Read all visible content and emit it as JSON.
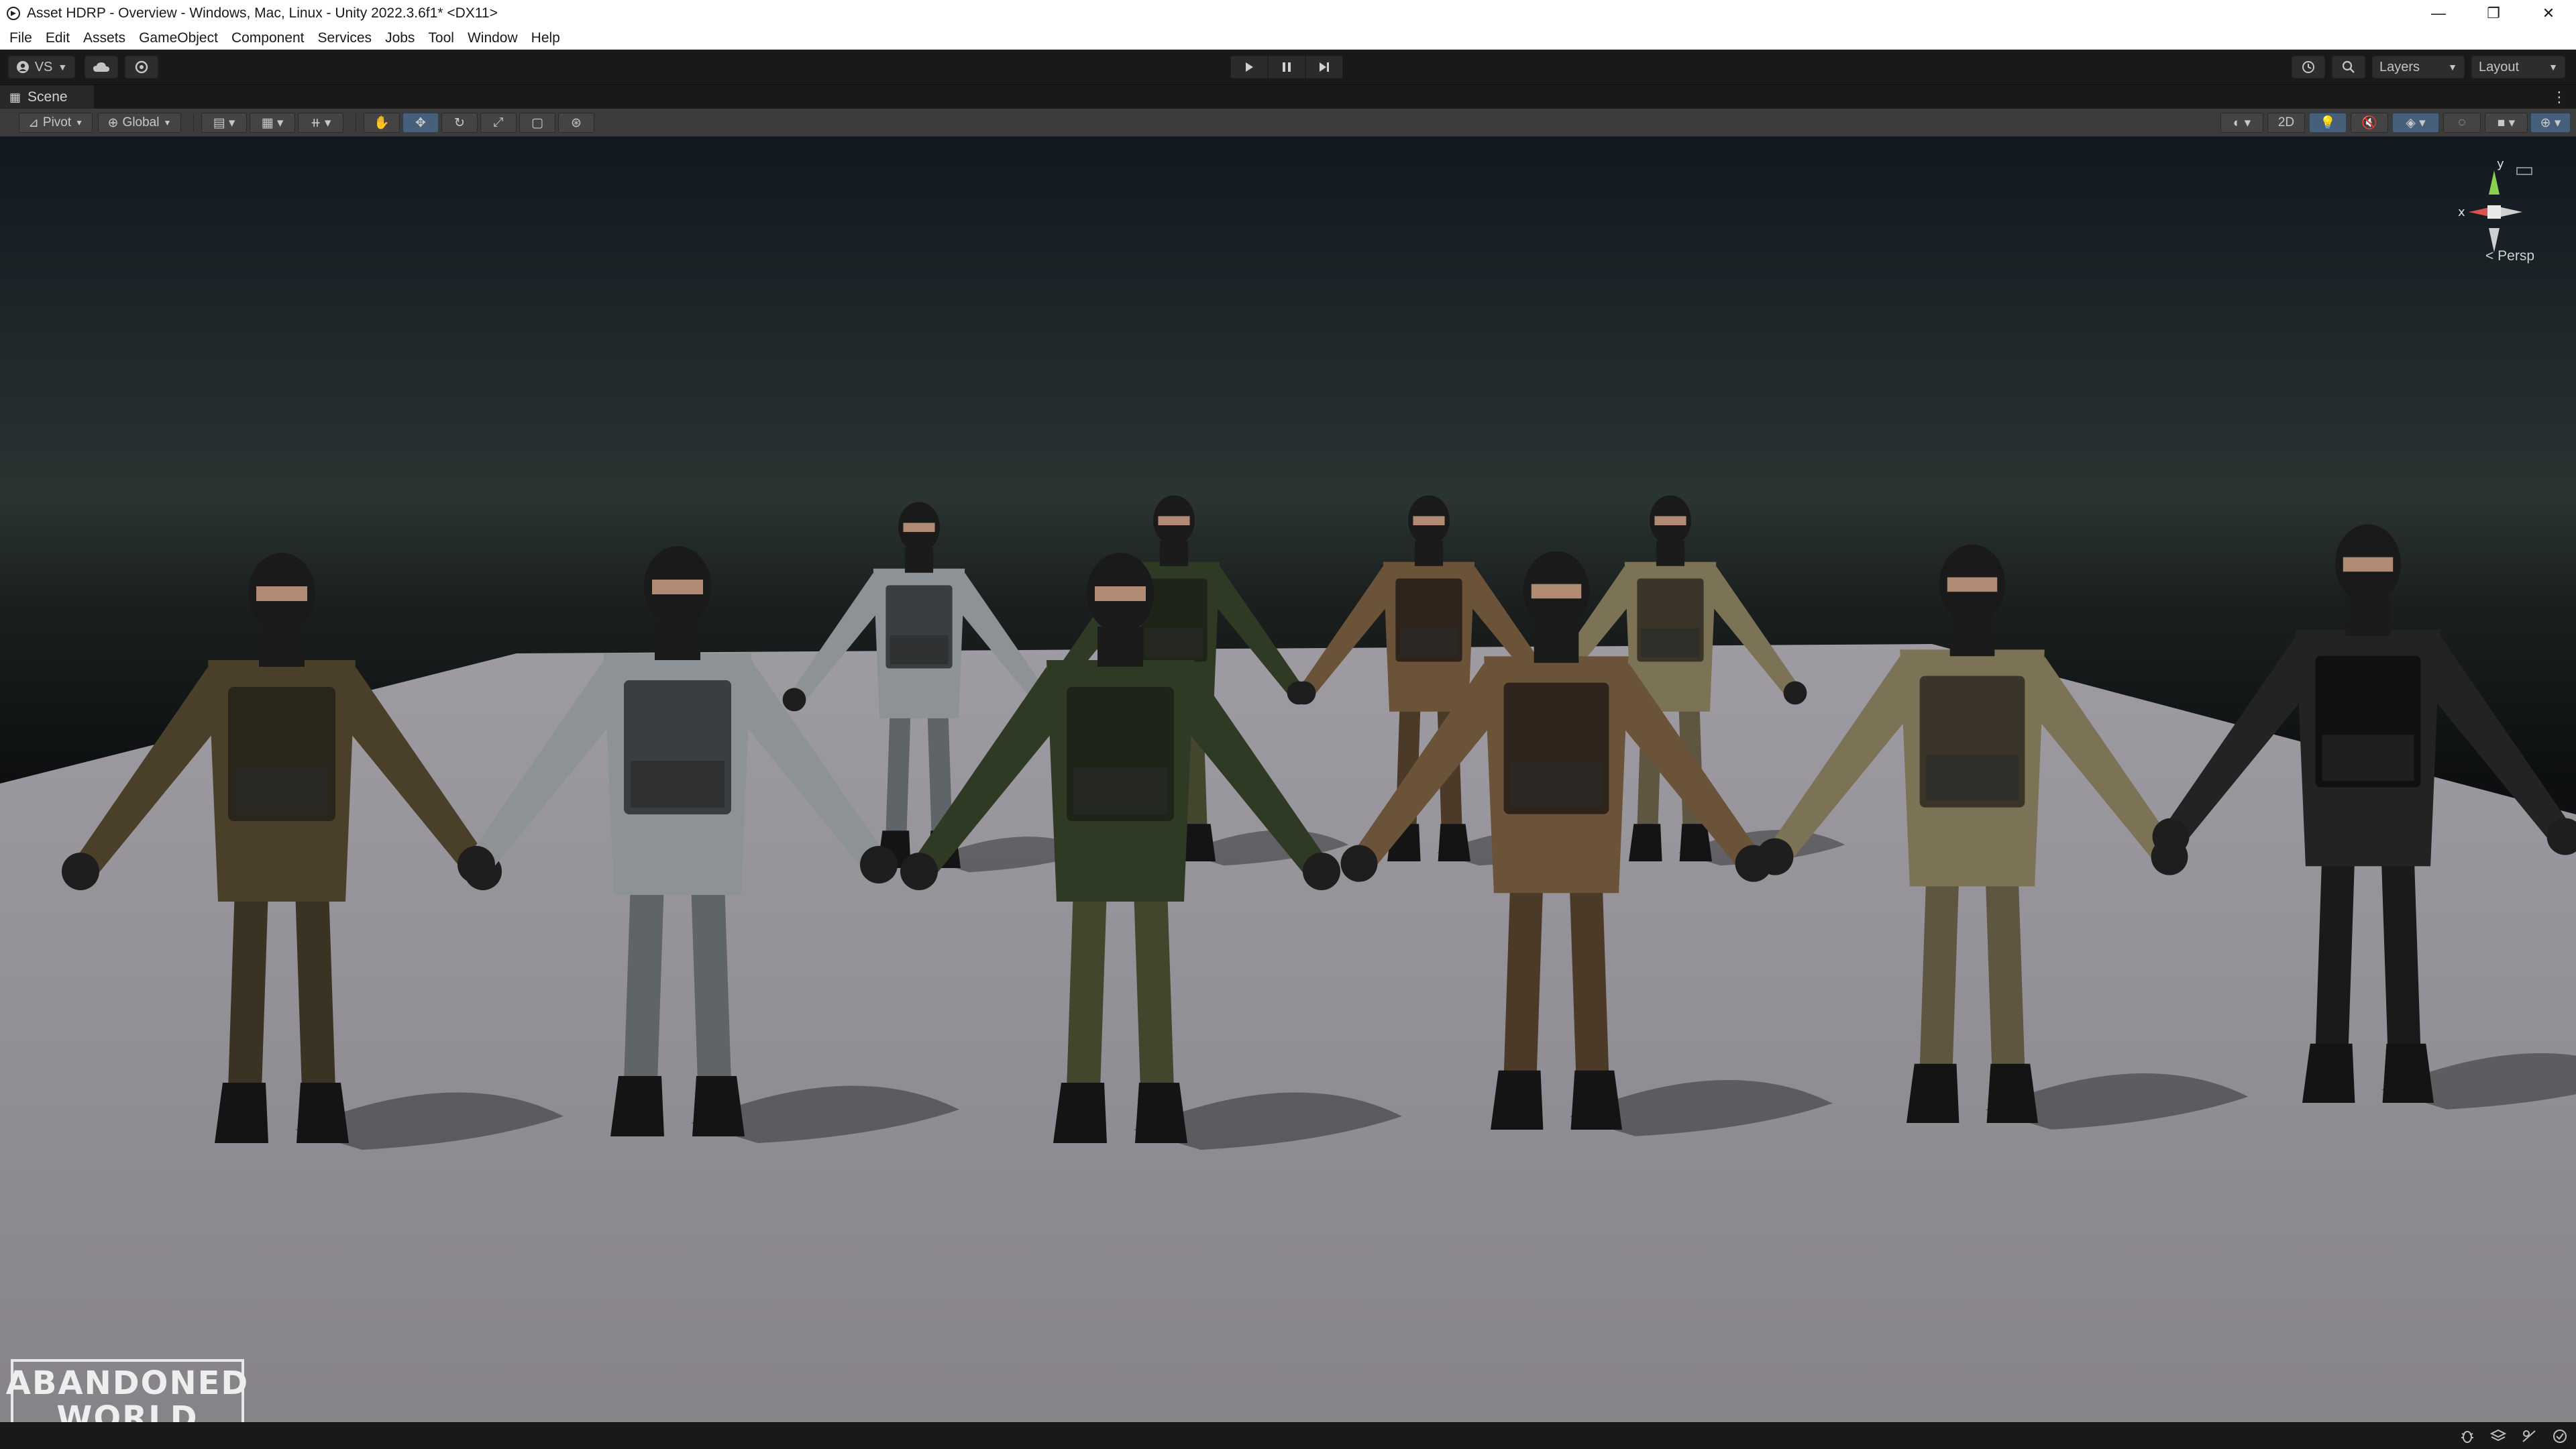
{
  "window": {
    "title": "Asset HDRP - Overview - Windows, Mac, Linux - Unity 2022.3.6f1* <DX11>",
    "minimize_glyph": "—",
    "restore_glyph": "❐",
    "close_glyph": "✕"
  },
  "menu": [
    "File",
    "Edit",
    "Assets",
    "GameObject",
    "Component",
    "Services",
    "Jobs",
    "Tool",
    "Window",
    "Help"
  ],
  "toolbar": {
    "account_label": "VS",
    "layers_label": "Layers",
    "layout_label": "Layout"
  },
  "scene_tab": {
    "label": "Scene",
    "menu_glyph": "⋮"
  },
  "scene_toolbar": {
    "pivot_label": "Pivot",
    "global_label": "Global",
    "mode_2d_label": "2D"
  },
  "viewport": {
    "projection_label": "Persp",
    "gizmo_axes": {
      "x": "x",
      "y": "y"
    },
    "watermark": {
      "line1": "ABANDONED",
      "line2": "WORLD"
    }
  },
  "colors": {
    "editor_bg": "#191919",
    "toolbar_bg": "#3c3c3c",
    "accent_active": "#46607c",
    "gizmo_x": "#d9534f",
    "gizmo_y": "#8bd14d",
    "floor": "#8e8b91",
    "sky_top": "#111820"
  },
  "characters": [
    {
      "camo": "olive-brown"
    },
    {
      "camo": "urban-grey"
    },
    {
      "camo": "woodland-green"
    },
    {
      "camo": "desert-brown"
    },
    {
      "camo": "desert-tan"
    },
    {
      "camo": "all-black"
    },
    {
      "camo": "urban-grey"
    },
    {
      "camo": "woodland-green"
    },
    {
      "camo": "desert-brown"
    },
    {
      "camo": "desert-tan"
    }
  ]
}
